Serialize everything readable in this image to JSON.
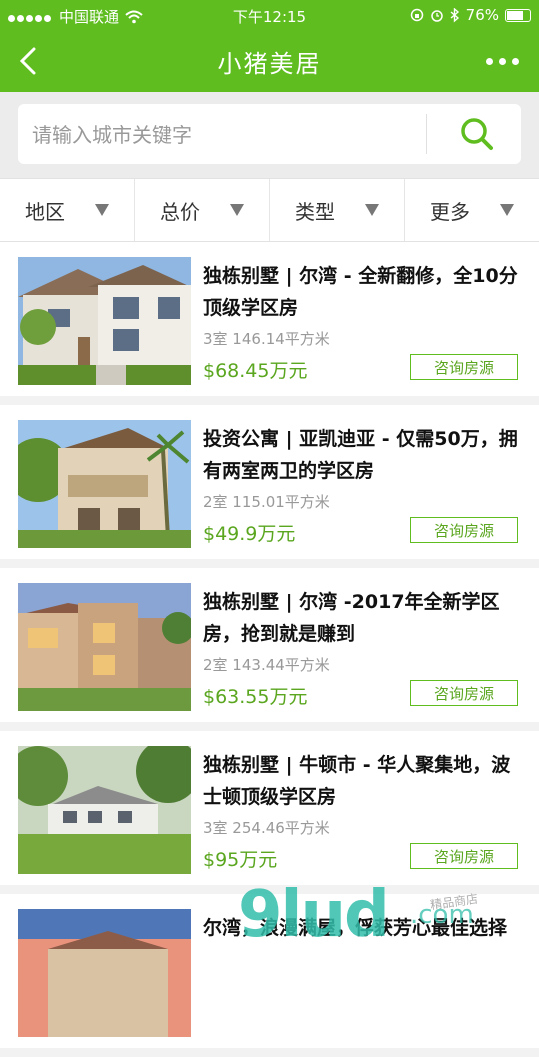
{
  "status_bar": {
    "carrier": "中国联通",
    "time": "下午12:15",
    "battery": "76%"
  },
  "navbar": {
    "title": "小猪美居"
  },
  "search": {
    "placeholder": "请输入城市关键字"
  },
  "filters": [
    {
      "label": "地区"
    },
    {
      "label": "总价"
    },
    {
      "label": "类型"
    },
    {
      "label": "更多"
    }
  ],
  "listings": [
    {
      "title": "独栋别墅 | 尔湾 - 全新翻修，全10分顶级学区房",
      "meta": "3室 146.14平方米",
      "price": "$68.45万元",
      "button": "咨询房源"
    },
    {
      "title": "投资公寓 | 亚凯迪亚 - 仅需50万，拥有两室两卫的学区房",
      "meta": "2室 115.01平方米",
      "price": "$49.9万元",
      "button": "咨询房源"
    },
    {
      "title": "独栋别墅 | 尔湾 -2017年全新学区房，抢到就是赚到",
      "meta": "2室 143.44平方米",
      "price": "$63.55万元",
      "button": "咨询房源"
    },
    {
      "title": "独栋别墅 | 牛顿市 - 华人聚集地，波士顿顶级学区房",
      "meta": "3室 254.46平方米",
      "price": "$95万元",
      "button": "咨询房源"
    },
    {
      "title": "尔湾，浪漫满屋，俘获芳心最佳选择",
      "meta": "",
      "price": "",
      "button": ""
    }
  ],
  "watermark": {
    "main": "9lud",
    "suffix": ".com",
    "small": "精品商店"
  },
  "colors": {
    "brand_green": "#5fbd1f",
    "price_green": "#5aa61f"
  }
}
